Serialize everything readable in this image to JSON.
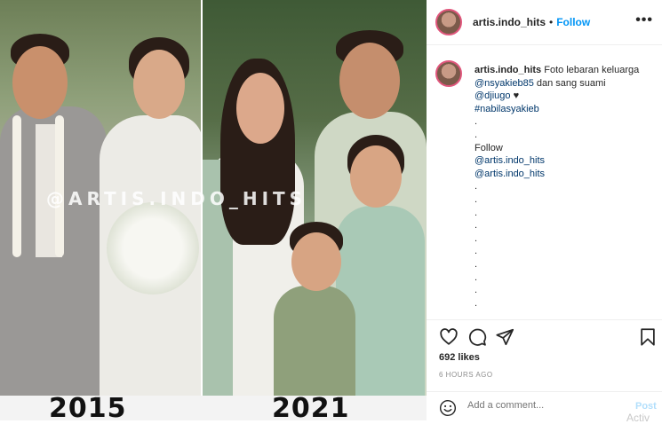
{
  "photo": {
    "watermark": "@ARTIS.INDO_HITS",
    "year_left": "2015",
    "year_right": "2021"
  },
  "header": {
    "username": "artis.indo_hits",
    "separator": "•",
    "follow_label": "Follow",
    "more_label": "•••"
  },
  "caption": {
    "username": "artis.indo_hits",
    "text": "Foto lebaran keluarga",
    "mention1": "@nsyakieb85",
    "text2": "dan sang suami",
    "mention2": "@djiugo",
    "heart": "♥",
    "hashtag": "#nabilasyakieb",
    "dots_a": [
      ".",
      "."
    ],
    "follow_word": "Follow",
    "mention3": "@artis.indo_hits",
    "mention4": "@artis.indo_hits",
    "dots_b": [
      ".",
      ".",
      ".",
      ".",
      ".",
      ".",
      ".",
      ".",
      ".",
      "."
    ]
  },
  "actions": {
    "likes": "692 likes",
    "time_ago": "6 HOURS AGO",
    "comment_placeholder": "Add a comment...",
    "post_label": "Post",
    "overlay_text": "Activ"
  },
  "colors": {
    "follow": "#0095f6",
    "link": "#00376b",
    "post_disabled": "#b2dffc",
    "story_ring": "#e0567c"
  },
  "icons": [
    "heart-icon",
    "comment-icon",
    "share-icon",
    "bookmark-icon",
    "emoji-icon"
  ]
}
